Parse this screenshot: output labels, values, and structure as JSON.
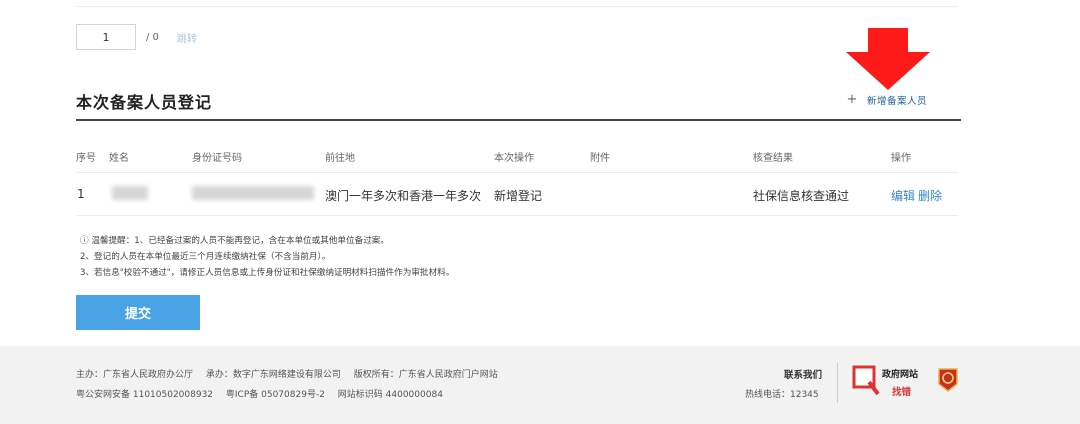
{
  "pager": {
    "page_value": "1",
    "total": "/ 0",
    "jump_label": "跳转"
  },
  "section": {
    "title": "本次备案人员登记",
    "add_icon": "plus-icon",
    "add_label": "新增备案人员"
  },
  "table": {
    "headers": [
      "序号",
      "姓名",
      "身份证号码",
      "前往地",
      "本次操作",
      "附件",
      "核查结果",
      "操作"
    ],
    "rows": [
      {
        "index": "1",
        "destination": "澳门一年多次和香港一年多次",
        "operation": "新增登记",
        "attachment": "",
        "result": "社保信息核查通过",
        "edit": "编辑",
        "delete": "删除"
      }
    ]
  },
  "notes": [
    "ⓘ 温馨提醒：1、已经备过案的人员不能再登记，含在本单位或其他单位备过案。",
    "2、登记的人员在本单位最近三个月连续缴纳社保（不含当前月）。",
    "3、若信息\"校验不通过\"，请修正人员信息或上传身份证和社保缴纳证明材料扫描件作为审批材料。"
  ],
  "submit_label": "提交",
  "footer": {
    "sponsor": "主办：广东省人民政府办公厅",
    "undertaker": "承办：数字广东网络建设有限公司",
    "copyright": "版权所有：广东省人民政府门户网站",
    "police_record": "粤公安网安备 11010502008932",
    "icp": "粤ICP备 05070829号-2",
    "site_code": "网站标识码 4400000084",
    "contact_title": "联系我们",
    "hotline": "热线电话：12345",
    "badge_top": "政府网站",
    "badge_bottom": "找错"
  },
  "colors": {
    "accent": "#4aa3e4",
    "link": "#3a86c9",
    "annotation_arrow": "#ff1a1a"
  }
}
